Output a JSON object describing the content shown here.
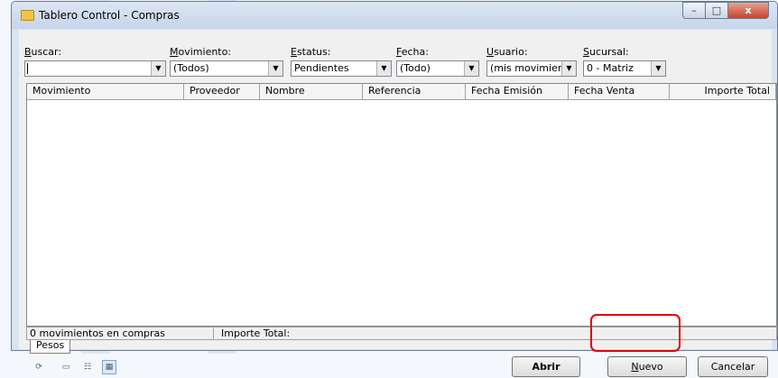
{
  "window": {
    "title": "Tablero Control - Compras",
    "controls": {
      "minimize": "–",
      "maximize": "□",
      "close": "x"
    }
  },
  "filters": [
    {
      "label_first": "B",
      "label_rest": "uscar:",
      "value": ""
    },
    {
      "label_first": "M",
      "label_rest": "ovimiento:",
      "value": "(Todos)"
    },
    {
      "label_first": "E",
      "label_rest": "status:",
      "value": "Pendientes"
    },
    {
      "label_first": "F",
      "label_rest": "echa:",
      "value": "(Todo)"
    },
    {
      "label_first": "U",
      "label_rest": "suario:",
      "value": "(mis movimien"
    },
    {
      "label_first": "S",
      "label_rest": "ucursal:",
      "value": "0 - Matriz"
    }
  ],
  "grid": {
    "columns": [
      "Movimiento",
      "Proveedor",
      "Nombre",
      "Referencia",
      "Fecha Emisión",
      "Fecha Venta",
      "Importe Total"
    ]
  },
  "status": {
    "count_text": "0 movimientos en compras",
    "total_label": "Importe Total:"
  },
  "tabs": [
    "Pesos"
  ],
  "buttons": {
    "abrir": "Abrir",
    "nuevo_first": "N",
    "nuevo_rest": "uevo",
    "cancelar": "Cancelar"
  },
  "highlight_color": "#e00000"
}
